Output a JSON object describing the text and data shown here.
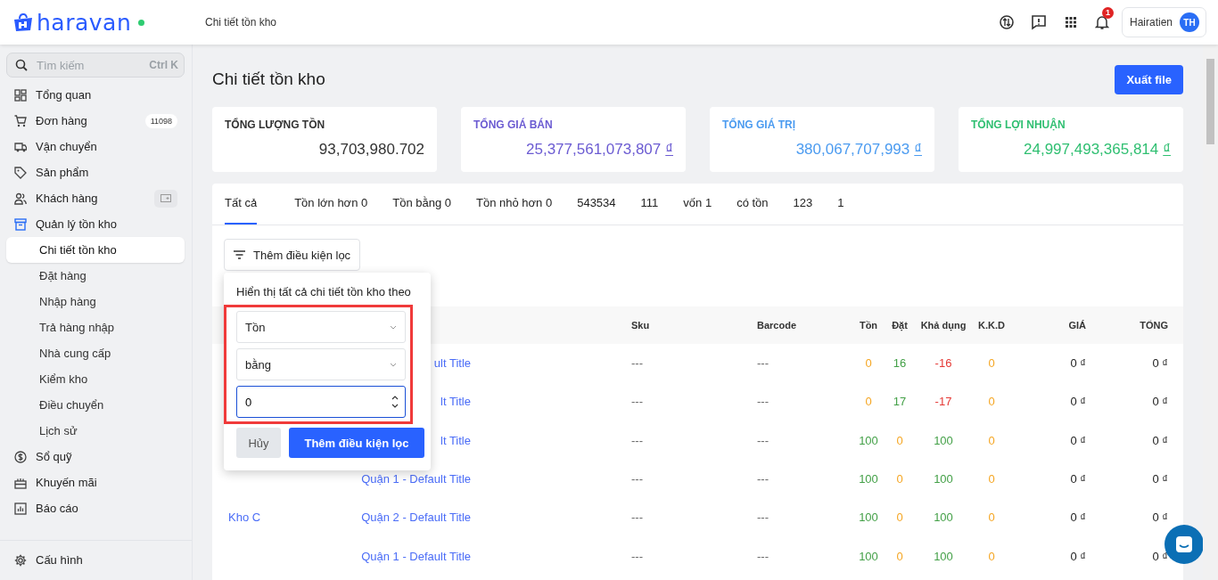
{
  "header": {
    "logo": "haravan",
    "online": true,
    "breadcrumb": "Chi tiết tồn kho",
    "notifications": "1",
    "user": {
      "name": "Hairatien",
      "initials": "TH"
    }
  },
  "sidebar": {
    "search": {
      "placeholder": "Tìm kiếm",
      "shortcut": "Ctrl K"
    },
    "items": [
      {
        "label": "Tổng quan"
      },
      {
        "label": "Đơn hàng",
        "badge": "11098"
      },
      {
        "label": "Vận chuyển"
      },
      {
        "label": "Sản phẩm"
      },
      {
        "label": "Khách hàng",
        "has_action": true
      },
      {
        "label": "Quản lý tồn kho",
        "children": [
          {
            "label": "Chi tiết tồn kho",
            "selected": true
          },
          {
            "label": "Đặt hàng",
            "selected": false
          },
          {
            "label": "Nhập hàng",
            "selected": false
          },
          {
            "label": "Trả hàng nhập",
            "selected": false
          },
          {
            "label": "Nhà cung cấp",
            "selected": false
          },
          {
            "label": "Kiểm kho",
            "selected": false
          },
          {
            "label": "Điều chuyển",
            "selected": false
          },
          {
            "label": "Lịch sử",
            "selected": false
          }
        ]
      },
      {
        "label": "Sổ quỹ"
      },
      {
        "label": "Khuyến mãi"
      },
      {
        "label": "Báo cáo"
      }
    ],
    "footer": {
      "label": "Cấu hình"
    }
  },
  "page": {
    "title": "Chi tiết tồn kho",
    "export_button": "Xuất file"
  },
  "stats": [
    {
      "label": "TỔNG LƯỢNG TỒN",
      "value": "93,703,980.702",
      "color": "#333333"
    },
    {
      "label": "TỔNG GIÁ BÁN",
      "value": "25,377,561,073,807",
      "currency": "₫",
      "color": "#6b5bd2"
    },
    {
      "label": "TỔNG GIÁ TRỊ",
      "value": "380,067,707,993",
      "currency": "₫",
      "color": "#4b9bf0"
    },
    {
      "label": "TỔNG LỢI NHUẬN",
      "value": "24,997,493,365,814",
      "currency": "₫",
      "color": "#2fbf71"
    }
  ],
  "tabs": [
    {
      "label": "Tất cả",
      "selected": true
    },
    {
      "label": "Tồn lớn hơn 0",
      "selected": false
    },
    {
      "label": "Tồn bằng 0",
      "selected": false
    },
    {
      "label": "Tồn nhỏ hơn 0",
      "selected": false
    },
    {
      "label": "543534",
      "selected": false
    },
    {
      "label": "111",
      "selected": false
    },
    {
      "label": "vốn 1",
      "selected": false
    },
    {
      "label": "có tồn",
      "selected": false
    },
    {
      "label": "123",
      "selected": false
    },
    {
      "label": "1",
      "selected": false
    }
  ],
  "filter_button": "Thêm điều kiện lọc",
  "filter_popover": {
    "title": "Hiển thị tất cả chi tiết tồn kho theo",
    "field": "Tồn",
    "operator": "bằng",
    "value": "0",
    "cancel": "Hủy",
    "submit": "Thêm điều kiện lọc"
  },
  "table": {
    "columns": [
      "Sku",
      "Barcode",
      "Tồn",
      "Đặt",
      "Khả dụng",
      "K.K.D",
      "GIÁ",
      "TỔNG"
    ],
    "rows": [
      {
        "variant": "ult Title",
        "sku": "---",
        "barcode": "---",
        "stock": {
          "text": "0",
          "color": "#f5a623"
        },
        "ordered": {
          "text": "16",
          "color": "#43a047"
        },
        "available": {
          "text": "-16",
          "color": "#e53935"
        },
        "kkd": {
          "text": "0",
          "color": "#f5a623"
        },
        "price": "0 ₫",
        "total": "0 ₫"
      },
      {
        "variant": "lt Title",
        "sku": "---",
        "barcode": "---",
        "stock": {
          "text": "0",
          "color": "#f5a623"
        },
        "ordered": {
          "text": "17",
          "color": "#43a047"
        },
        "available": {
          "text": "-17",
          "color": "#e53935"
        },
        "kkd": {
          "text": "0",
          "color": "#f5a623"
        },
        "price": "0 ₫",
        "total": "0 ₫"
      },
      {
        "variant": "lt Title",
        "sku": "---",
        "barcode": "---",
        "stock": {
          "text": "100",
          "color": "#43a047"
        },
        "ordered": {
          "text": "0",
          "color": "#f5a623"
        },
        "available": {
          "text": "100",
          "color": "#43a047"
        },
        "kkd": {
          "text": "0",
          "color": "#f5a623"
        },
        "price": "0 ₫",
        "total": "0 ₫"
      },
      {
        "variant": "Quận 1 - Default Title",
        "sku": "---",
        "barcode": "---",
        "stock": {
          "text": "100",
          "color": "#43a047"
        },
        "ordered": {
          "text": "0",
          "color": "#f5a623"
        },
        "available": {
          "text": "100",
          "color": "#43a047"
        },
        "kkd": {
          "text": "0",
          "color": "#f5a623"
        },
        "price": "0 ₫",
        "total": "0 ₫"
      },
      {
        "warehouse": "Kho C",
        "variant": "Quận 2 - Default Title",
        "sku": "---",
        "barcode": "---",
        "stock": {
          "text": "100",
          "color": "#43a047"
        },
        "ordered": {
          "text": "0",
          "color": "#f5a623"
        },
        "available": {
          "text": "100",
          "color": "#43a047"
        },
        "kkd": {
          "text": "0",
          "color": "#f5a623"
        },
        "price": "0 ₫",
        "total": "0 ₫"
      },
      {
        "variant": "Quận 1 - Default Title",
        "sku": "---",
        "barcode": "---",
        "stock": {
          "text": "100",
          "color": "#43a047"
        },
        "ordered": {
          "text": "0",
          "color": "#f5a623"
        },
        "available": {
          "text": "100",
          "color": "#43a047"
        },
        "kkd": {
          "text": "0",
          "color": "#f5a623"
        },
        "price": "0 ₫",
        "total": "0 ₫"
      }
    ]
  }
}
